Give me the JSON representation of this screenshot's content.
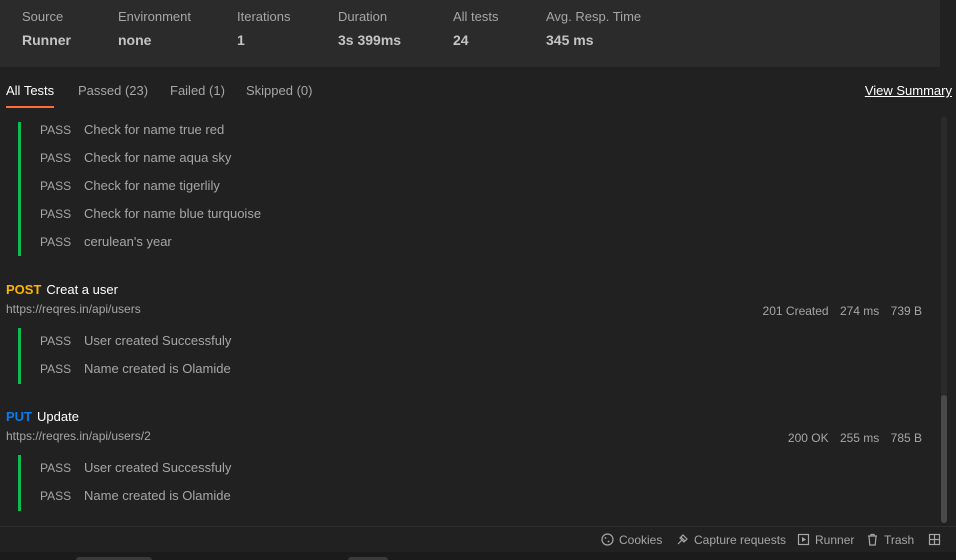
{
  "summary": {
    "source": {
      "label": "Source",
      "value": "Runner"
    },
    "environment": {
      "label": "Environment",
      "value": "none"
    },
    "iterations": {
      "label": "Iterations",
      "value": "1"
    },
    "duration": {
      "label": "Duration",
      "value": "3s 399ms"
    },
    "all_tests": {
      "label": "All tests",
      "value": "24"
    },
    "avg_resp": {
      "label": "Avg. Resp. Time",
      "value": "345 ms"
    }
  },
  "tabs": {
    "all": "All Tests",
    "passed": "Passed (23)",
    "failed": "Failed (1)",
    "skipped": "Skipped (0)",
    "view_summary": "View Summary"
  },
  "colors": {
    "accent": "#ff6c37",
    "pass_bar": "#0cbb52",
    "post": "#ffb400",
    "put": "#097bed"
  },
  "group1": {
    "tests": [
      {
        "status": "PASS",
        "name": "Check for name true red"
      },
      {
        "status": "PASS",
        "name": "Check for name aqua sky"
      },
      {
        "status": "PASS",
        "name": "Check for name tigerlily"
      },
      {
        "status": "PASS",
        "name": "Check for name blue turquoise"
      },
      {
        "status": "PASS",
        "name": "cerulean's year"
      }
    ]
  },
  "request_post": {
    "method": "POST",
    "name": "Creat a user",
    "url": "https://reqres.in/api/users",
    "status": "201 Created",
    "time": "274 ms",
    "size": "739 B",
    "tests": [
      {
        "status": "PASS",
        "name": "User created Successfuly"
      },
      {
        "status": "PASS",
        "name": "Name created is Olamide"
      }
    ]
  },
  "request_put": {
    "method": "PUT",
    "name": "Update",
    "url": "https://reqres.in/api/users/2",
    "status": "200 OK",
    "time": "255 ms",
    "size": "785 B",
    "tests": [
      {
        "status": "PASS",
        "name": "User created Successfuly"
      },
      {
        "status": "PASS",
        "name": "Name created is Olamide"
      }
    ]
  },
  "footer": {
    "cookies": "Cookies",
    "capture": "Capture requests",
    "runner": "Runner",
    "trash": "Trash",
    "icons": [
      "cookie-icon",
      "capture-icon",
      "runner-icon",
      "trash-icon",
      "layout-icon"
    ]
  }
}
